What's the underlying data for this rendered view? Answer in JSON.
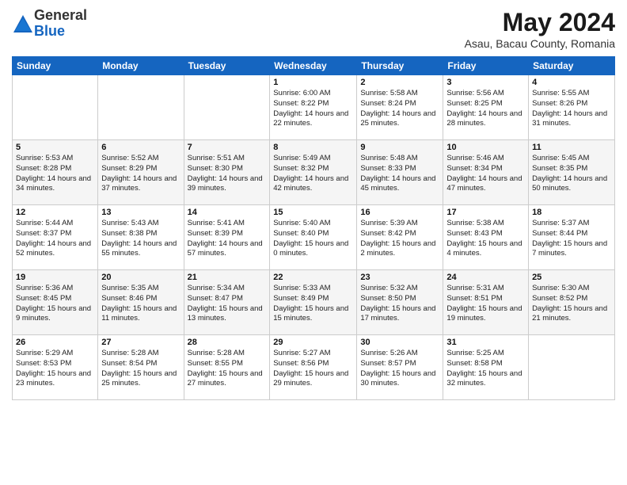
{
  "logo": {
    "general": "General",
    "blue": "Blue"
  },
  "title": "May 2024",
  "location": "Asau, Bacau County, Romania",
  "days_of_week": [
    "Sunday",
    "Monday",
    "Tuesday",
    "Wednesday",
    "Thursday",
    "Friday",
    "Saturday"
  ],
  "weeks": [
    [
      {
        "num": "",
        "sunrise": "",
        "sunset": "",
        "daylight": "",
        "empty": true
      },
      {
        "num": "",
        "sunrise": "",
        "sunset": "",
        "daylight": "",
        "empty": true
      },
      {
        "num": "",
        "sunrise": "",
        "sunset": "",
        "daylight": "",
        "empty": true
      },
      {
        "num": "1",
        "sunrise": "Sunrise: 6:00 AM",
        "sunset": "Sunset: 8:22 PM",
        "daylight": "Daylight: 14 hours and 22 minutes."
      },
      {
        "num": "2",
        "sunrise": "Sunrise: 5:58 AM",
        "sunset": "Sunset: 8:24 PM",
        "daylight": "Daylight: 14 hours and 25 minutes."
      },
      {
        "num": "3",
        "sunrise": "Sunrise: 5:56 AM",
        "sunset": "Sunset: 8:25 PM",
        "daylight": "Daylight: 14 hours and 28 minutes."
      },
      {
        "num": "4",
        "sunrise": "Sunrise: 5:55 AM",
        "sunset": "Sunset: 8:26 PM",
        "daylight": "Daylight: 14 hours and 31 minutes."
      }
    ],
    [
      {
        "num": "5",
        "sunrise": "Sunrise: 5:53 AM",
        "sunset": "Sunset: 8:28 PM",
        "daylight": "Daylight: 14 hours and 34 minutes."
      },
      {
        "num": "6",
        "sunrise": "Sunrise: 5:52 AM",
        "sunset": "Sunset: 8:29 PM",
        "daylight": "Daylight: 14 hours and 37 minutes."
      },
      {
        "num": "7",
        "sunrise": "Sunrise: 5:51 AM",
        "sunset": "Sunset: 8:30 PM",
        "daylight": "Daylight: 14 hours and 39 minutes."
      },
      {
        "num": "8",
        "sunrise": "Sunrise: 5:49 AM",
        "sunset": "Sunset: 8:32 PM",
        "daylight": "Daylight: 14 hours and 42 minutes."
      },
      {
        "num": "9",
        "sunrise": "Sunrise: 5:48 AM",
        "sunset": "Sunset: 8:33 PM",
        "daylight": "Daylight: 14 hours and 45 minutes."
      },
      {
        "num": "10",
        "sunrise": "Sunrise: 5:46 AM",
        "sunset": "Sunset: 8:34 PM",
        "daylight": "Daylight: 14 hours and 47 minutes."
      },
      {
        "num": "11",
        "sunrise": "Sunrise: 5:45 AM",
        "sunset": "Sunset: 8:35 PM",
        "daylight": "Daylight: 14 hours and 50 minutes."
      }
    ],
    [
      {
        "num": "12",
        "sunrise": "Sunrise: 5:44 AM",
        "sunset": "Sunset: 8:37 PM",
        "daylight": "Daylight: 14 hours and 52 minutes."
      },
      {
        "num": "13",
        "sunrise": "Sunrise: 5:43 AM",
        "sunset": "Sunset: 8:38 PM",
        "daylight": "Daylight: 14 hours and 55 minutes."
      },
      {
        "num": "14",
        "sunrise": "Sunrise: 5:41 AM",
        "sunset": "Sunset: 8:39 PM",
        "daylight": "Daylight: 14 hours and 57 minutes."
      },
      {
        "num": "15",
        "sunrise": "Sunrise: 5:40 AM",
        "sunset": "Sunset: 8:40 PM",
        "daylight": "Daylight: 15 hours and 0 minutes."
      },
      {
        "num": "16",
        "sunrise": "Sunrise: 5:39 AM",
        "sunset": "Sunset: 8:42 PM",
        "daylight": "Daylight: 15 hours and 2 minutes."
      },
      {
        "num": "17",
        "sunrise": "Sunrise: 5:38 AM",
        "sunset": "Sunset: 8:43 PM",
        "daylight": "Daylight: 15 hours and 4 minutes."
      },
      {
        "num": "18",
        "sunrise": "Sunrise: 5:37 AM",
        "sunset": "Sunset: 8:44 PM",
        "daylight": "Daylight: 15 hours and 7 minutes."
      }
    ],
    [
      {
        "num": "19",
        "sunrise": "Sunrise: 5:36 AM",
        "sunset": "Sunset: 8:45 PM",
        "daylight": "Daylight: 15 hours and 9 minutes."
      },
      {
        "num": "20",
        "sunrise": "Sunrise: 5:35 AM",
        "sunset": "Sunset: 8:46 PM",
        "daylight": "Daylight: 15 hours and 11 minutes."
      },
      {
        "num": "21",
        "sunrise": "Sunrise: 5:34 AM",
        "sunset": "Sunset: 8:47 PM",
        "daylight": "Daylight: 15 hours and 13 minutes."
      },
      {
        "num": "22",
        "sunrise": "Sunrise: 5:33 AM",
        "sunset": "Sunset: 8:49 PM",
        "daylight": "Daylight: 15 hours and 15 minutes."
      },
      {
        "num": "23",
        "sunrise": "Sunrise: 5:32 AM",
        "sunset": "Sunset: 8:50 PM",
        "daylight": "Daylight: 15 hours and 17 minutes."
      },
      {
        "num": "24",
        "sunrise": "Sunrise: 5:31 AM",
        "sunset": "Sunset: 8:51 PM",
        "daylight": "Daylight: 15 hours and 19 minutes."
      },
      {
        "num": "25",
        "sunrise": "Sunrise: 5:30 AM",
        "sunset": "Sunset: 8:52 PM",
        "daylight": "Daylight: 15 hours and 21 minutes."
      }
    ],
    [
      {
        "num": "26",
        "sunrise": "Sunrise: 5:29 AM",
        "sunset": "Sunset: 8:53 PM",
        "daylight": "Daylight: 15 hours and 23 minutes."
      },
      {
        "num": "27",
        "sunrise": "Sunrise: 5:28 AM",
        "sunset": "Sunset: 8:54 PM",
        "daylight": "Daylight: 15 hours and 25 minutes."
      },
      {
        "num": "28",
        "sunrise": "Sunrise: 5:28 AM",
        "sunset": "Sunset: 8:55 PM",
        "daylight": "Daylight: 15 hours and 27 minutes."
      },
      {
        "num": "29",
        "sunrise": "Sunrise: 5:27 AM",
        "sunset": "Sunset: 8:56 PM",
        "daylight": "Daylight: 15 hours and 29 minutes."
      },
      {
        "num": "30",
        "sunrise": "Sunrise: 5:26 AM",
        "sunset": "Sunset: 8:57 PM",
        "daylight": "Daylight: 15 hours and 30 minutes."
      },
      {
        "num": "31",
        "sunrise": "Sunrise: 5:25 AM",
        "sunset": "Sunset: 8:58 PM",
        "daylight": "Daylight: 15 hours and 32 minutes."
      },
      {
        "num": "",
        "sunrise": "",
        "sunset": "",
        "daylight": "",
        "empty": true
      }
    ]
  ]
}
